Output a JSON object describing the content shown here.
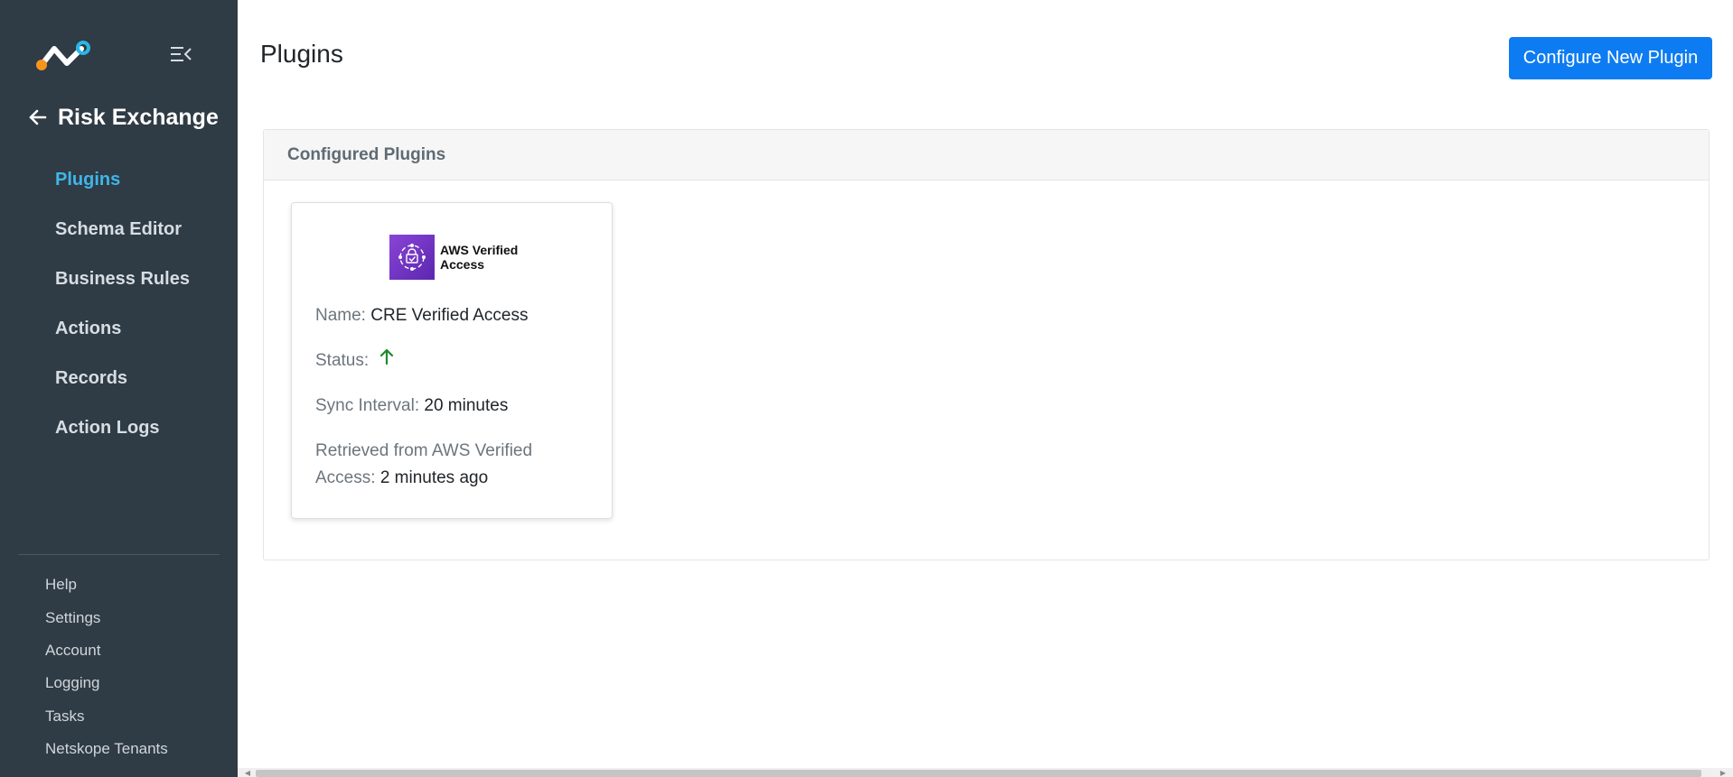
{
  "sidebar": {
    "logo_icon": "netskope-logo-icon",
    "collapse_icon": "menu-collapse-icon",
    "back_icon": "arrow-left-icon",
    "module_title": "Risk Exchange",
    "items": [
      {
        "label": "Plugins",
        "active": true
      },
      {
        "label": "Schema Editor",
        "active": false
      },
      {
        "label": "Business Rules",
        "active": false
      },
      {
        "label": "Actions",
        "active": false
      },
      {
        "label": "Records",
        "active": false
      },
      {
        "label": "Action Logs",
        "active": false
      }
    ],
    "bottom_items": [
      "Help",
      "Settings",
      "Account",
      "Logging",
      "Tasks",
      "Netskope Tenants"
    ]
  },
  "header": {
    "title": "Plugins",
    "primary_button": "Configure New Plugin"
  },
  "panel": {
    "title": "Configured Plugins"
  },
  "plugin_card": {
    "logo_text": "AWS Verified Access",
    "name_label": "Name:",
    "name_value": "CRE Verified Access",
    "status_label": "Status:",
    "status_icon": "arrow-up-icon",
    "sync_label": "Sync Interval:",
    "sync_value": "20 minutes",
    "retrieved_label_1": "Retrieved from AWS Verified",
    "retrieved_label_2": "Access:",
    "retrieved_value": "2 minutes ago"
  },
  "colors": {
    "sidebar_bg": "#2f3b45",
    "active_nav": "#3fb6e8",
    "primary": "#0d7cf2",
    "status_up": "#1e8a2e"
  }
}
